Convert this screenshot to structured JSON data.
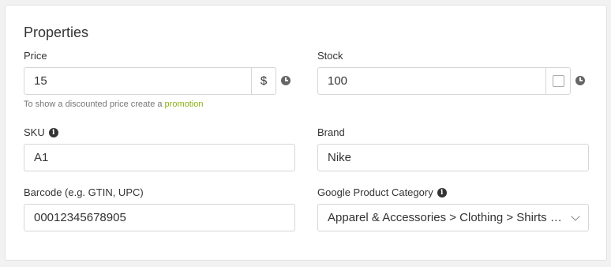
{
  "section": {
    "title": "Properties"
  },
  "price": {
    "label": "Price",
    "value": "15",
    "currency": "$",
    "hint_prefix": "To show a discounted price create a ",
    "hint_link": "promotion"
  },
  "stock": {
    "label": "Stock",
    "value": "100",
    "unlimited_checked": false
  },
  "sku": {
    "label": "SKU",
    "info_icon": "i",
    "value": "A1"
  },
  "brand": {
    "label": "Brand",
    "value": "Nike"
  },
  "barcode": {
    "label": "Barcode (e.g. GTIN, UPC)",
    "value": "00012345678905"
  },
  "google_category": {
    "label": "Google Product Category",
    "info_icon": "i",
    "value": "Apparel & Accessories > Clothing > Shirts & Tops"
  },
  "colors": {
    "link": "#8ab217",
    "border": "#d6d6d6"
  }
}
